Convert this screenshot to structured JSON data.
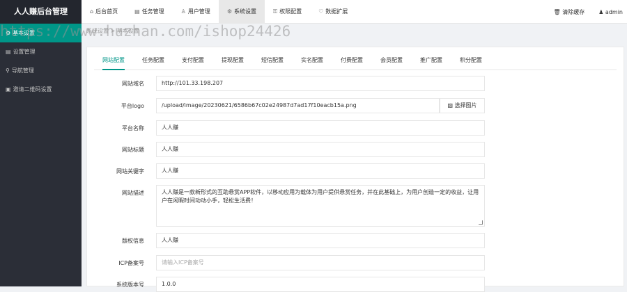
{
  "brand": {
    "title": "人人赚后台管理"
  },
  "topnav": [
    {
      "icon": "⌂",
      "label": "后台首页",
      "active": false
    },
    {
      "icon": "▤",
      "label": "任务管理",
      "active": false
    },
    {
      "icon": "♙",
      "label": "用户管理",
      "active": false
    },
    {
      "icon": "⚙",
      "label": "系统设置",
      "active": true
    },
    {
      "icon": "⚿",
      "label": "权限配置",
      "active": false
    },
    {
      "icon": "♡",
      "label": "数据扩展",
      "active": false
    }
  ],
  "topright": {
    "clear_cache_icon": "🗑",
    "clear_cache": "清除缓存",
    "user_icon": "♟",
    "user": "admin"
  },
  "sidebar": [
    {
      "icon": "⚙",
      "label": "基本设置",
      "active": true
    },
    {
      "icon": "▤",
      "label": "设置管理",
      "active": false
    },
    {
      "icon": "⚲",
      "label": "导航管理",
      "active": false
    },
    {
      "icon": "▣",
      "label": "邀请二维码设置",
      "active": false
    }
  ],
  "breadcrumb": "系统设置 > 基本设置",
  "watermark": "https://www.huzhan.com/ishop24426",
  "tabs": [
    "网站配置",
    "任务配置",
    "支付配置",
    "提现配置",
    "短信配置",
    "实名配置",
    "付费配置",
    "会员配置",
    "推广配置",
    "积分配置"
  ],
  "form": {
    "site_domain": {
      "label": "网站域名",
      "value": "http://101.33.198.207"
    },
    "logo": {
      "label": "平台logo",
      "value": "/upload/image/20230621/6586b67c02e24987d7ad17f10eacb15a.png",
      "button": "选择图片",
      "button_icon": "▧"
    },
    "platform_name": {
      "label": "平台名称",
      "value": "人人赚"
    },
    "site_title": {
      "label": "网站标题",
      "value": "人人赚"
    },
    "keywords": {
      "label": "网站关键字",
      "value": "人人赚"
    },
    "description": {
      "label": "网站描述",
      "value": "人人赚是一款新形式的互助悬赏APP软件，以移动应用为载体为用户提供悬赏任务，并在此基础上，为用户创造一定的收益，让用户在闲暇时间动动小手，轻松生活费！"
    },
    "copyright": {
      "label": "版权信息",
      "value": "人人赚"
    },
    "icp": {
      "label": "ICP备案号",
      "placeholder": "请输入ICP备案号"
    },
    "version": {
      "label": "系统版本号",
      "value": "1.0.0"
    }
  }
}
